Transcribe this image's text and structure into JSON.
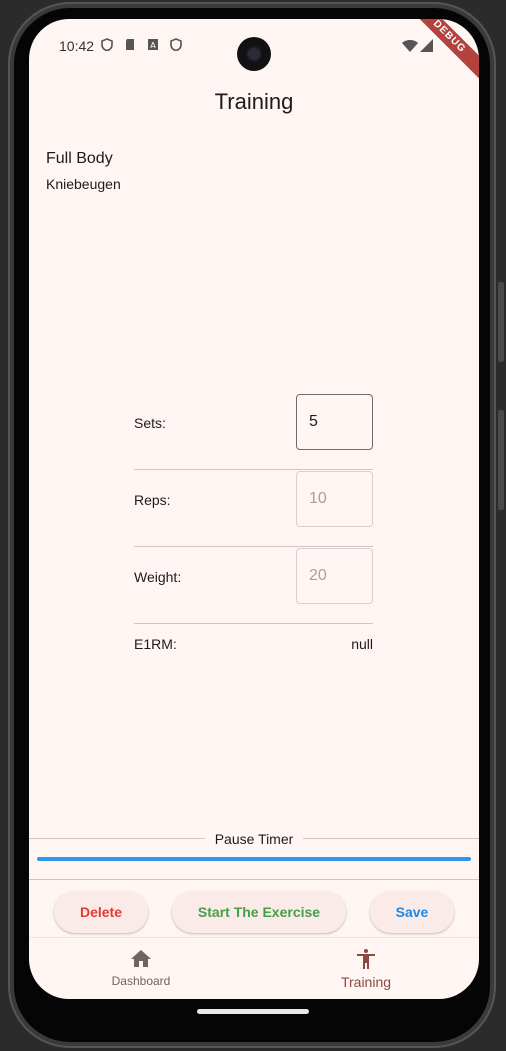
{
  "status_bar": {
    "time": "10:42",
    "debug_banner": "DEBUG"
  },
  "app_bar": {
    "title": "Training"
  },
  "workout": {
    "name": "Full Body",
    "exercise": "Kniebeugen"
  },
  "form": {
    "sets": {
      "label": "Sets:",
      "value": "5"
    },
    "reps": {
      "label": "Reps:",
      "placeholder": "10"
    },
    "weight": {
      "label": "Weight:",
      "placeholder": "20"
    },
    "e1rm": {
      "label": "E1RM:",
      "value": "null"
    }
  },
  "pause_timer": {
    "label": "Pause Timer",
    "progress": 1.0
  },
  "actions": {
    "delete_label": "Delete",
    "start_label": "Start The Exercise",
    "save_label": "Save"
  },
  "bottom_nav": {
    "items": [
      {
        "label": "Dashboard",
        "icon": "home-icon",
        "selected": false
      },
      {
        "label": "Training",
        "icon": "accessibility-icon",
        "selected": true
      }
    ]
  },
  "colors": {
    "background": "#fff5f3",
    "delete": "#e53935",
    "start": "#43a047",
    "save": "#1e88e5",
    "progress": "#2f96e8",
    "nav_selected": "#8b4a44",
    "nav_unselected": "#6f6462"
  }
}
